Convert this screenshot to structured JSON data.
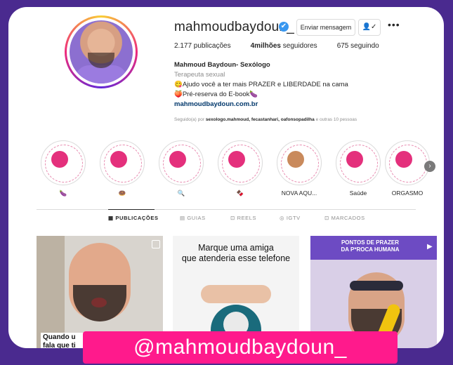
{
  "profile": {
    "username": "mahmoudbaydoun_",
    "verified_mark": "✔",
    "message_button": "Enviar mensagem",
    "follow_icon": "👤✓",
    "more": "•••",
    "stats": {
      "posts": "2.177 publicações",
      "followers_count": "4milhões",
      "followers_label": " seguidores",
      "following": "675 seguindo"
    },
    "bio": {
      "name": "Mahmoud Baydoun- Sexólogo",
      "category": "Terapeuta sexual",
      "line1": "😋Ajudo você a ter mais PRAZER e LIBERDADE na cama",
      "line2": "🍑Pré-reserva do E-book🍆",
      "link": "mahmoudbaydoun.com.br"
    },
    "followed_by": {
      "prefix": "Seguido(a) por ",
      "names": "sexologo.mahmoud, fecastanhari, oafonsopadilha",
      "suffix": " e outras 10 pessoas"
    }
  },
  "highlights": [
    {
      "label": "🍆"
    },
    {
      "label": "🍩"
    },
    {
      "label": "🔍"
    },
    {
      "label": "🍫"
    },
    {
      "label": "NOVA AQU..."
    },
    {
      "label": "Saúde"
    },
    {
      "label": "ORGASMO"
    }
  ],
  "tabs": {
    "posts": "▦ PUBLICAÇÕES",
    "guides": "▤ GUIAS",
    "reels": "⊡ REELS",
    "igtv": "◎ IGTV",
    "tagged": "⊡ MARCADOS"
  },
  "posts": [
    {
      "caption": "Quando u\nfala que ti"
    },
    {
      "caption": "Marque uma amiga\nque atenderia esse telefone"
    },
    {
      "caption": "PONTOS DE PRAZER\nDA P*ROCA HUMANA",
      "play": "▶"
    }
  ],
  "next_arrow": "›",
  "overlay_handle": "@mahmoudbaydoun_",
  "colors": {
    "background": "#4a2a8f",
    "accent": "#ff1a8c",
    "verified": "#3897f0"
  }
}
